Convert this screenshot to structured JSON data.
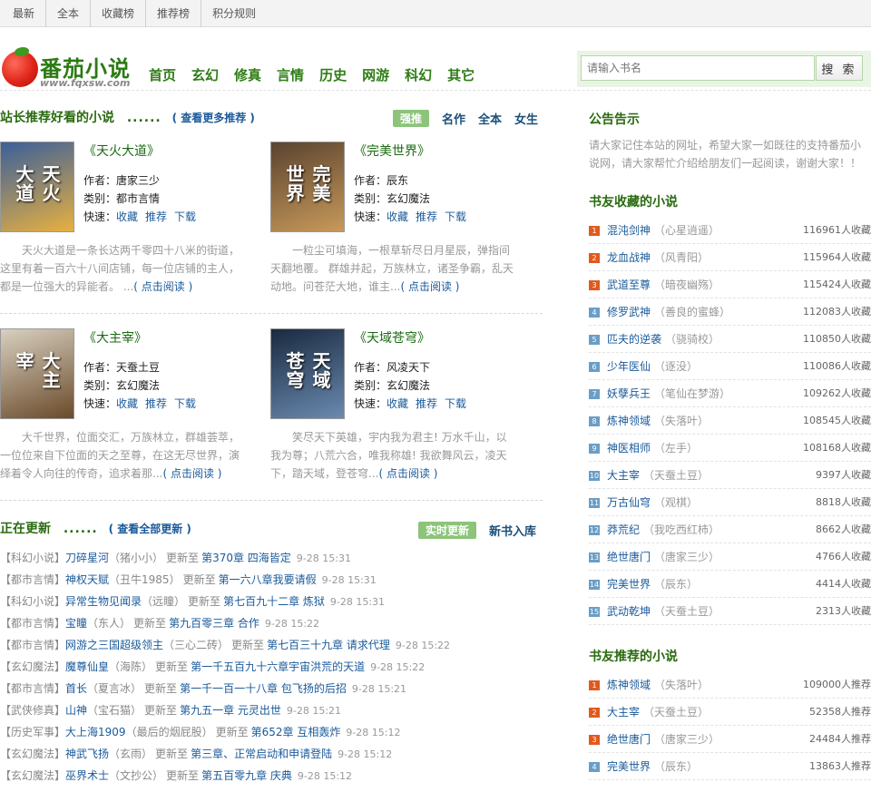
{
  "topnav": [
    "最新",
    "全本",
    "收藏榜",
    "推荐榜",
    "积分规则"
  ],
  "logo": {
    "text": "番茄小说",
    "url_text": "www.fqxsw.com",
    "icon": "tomato-icon"
  },
  "nav": [
    "首页",
    "玄幻",
    "修真",
    "言情",
    "历史",
    "网游",
    "科幻",
    "其它"
  ],
  "search": {
    "placeholder": "请输入书名",
    "button": "搜 索"
  },
  "recommend": {
    "title": "站长推荐好看的小说",
    "dots": "......",
    "more": "( 查看更多推荐 )",
    "tabs": [
      "强推",
      "名作",
      "全本",
      "女生"
    ],
    "labels": {
      "author": "作者：",
      "category": "类别：",
      "quick": "快速："
    },
    "quick_links": [
      "收藏",
      "推荐",
      "下载"
    ],
    "read_more": "( 点击阅读 )",
    "books": [
      {
        "title": "《天火大道》",
        "author": "唐家三少",
        "category": "都市言情",
        "cover_text": "天火大道",
        "cover_colors": [
          "#3a5f9a",
          "#e8b040"
        ],
        "desc": "天火大道是一条长达两千零四十八米的街道，这里有着一百六十八间店铺，每一位店铺的主人，都是一位强大的异能者。 ..."
      },
      {
        "title": "《完美世界》",
        "author": "辰东",
        "category": "玄幻魔法",
        "cover_text": "完美世界",
        "cover_colors": [
          "#5a4330",
          "#c89a5a"
        ],
        "desc": "一粒尘可填海，一根草斩尽日月星辰，弹指间天翻地覆。 群雄并起，万族林立，诸圣争霸，乱天动地。问苍茫大地，谁主..."
      },
      {
        "title": "《大主宰》",
        "author": "天蚕土豆",
        "category": "玄幻魔法",
        "cover_text": "大主宰",
        "cover_colors": [
          "#d8d0c0",
          "#6a4a2a"
        ],
        "desc": "大千世界，位面交汇，万族林立，群雄荟萃，一位位来自下位面的天之至尊，在这无尽世界，演绎着令人向往的传奇，追求着那..."
      },
      {
        "title": "《天域苍穹》",
        "author": "风凌天下",
        "category": "玄幻魔法",
        "cover_text": "天域苍穹",
        "cover_colors": [
          "#1a2a40",
          "#6a8ab0"
        ],
        "desc": "笑尽天下英雄，宇内我为君主! 万水千山，以我为尊；八荒六合，唯我称雄! 我欲舞风云，凌天下，踏天域，登苍穹..."
      }
    ]
  },
  "updates": {
    "title": "正在更新",
    "dots": "......",
    "more": "( 查看全部更新 )",
    "tabs": [
      "实时更新",
      "新书入库"
    ],
    "word_update": "更新至",
    "items": [
      {
        "cat": "【科幻小说】",
        "name": "刀碎星河",
        "author": "（猪小小）",
        "chapter": "第370章  四海皆定",
        "time": "9-28 15:31"
      },
      {
        "cat": "【都市言情】",
        "name": "神权天赋",
        "author": "（丑牛1985）",
        "chapter": "第一六八章我要请假",
        "time": "9-28 15:31"
      },
      {
        "cat": "【科幻小说】",
        "name": "异常生物见闻录",
        "author": "（远瞳）",
        "chapter": "第七百九十二章  炼狱",
        "time": "9-28 15:31"
      },
      {
        "cat": "【都市言情】",
        "name": "宝瞳",
        "author": "（东人）",
        "chapter": "第九百零三章  合作",
        "time": "9-28 15:22"
      },
      {
        "cat": "【都市言情】",
        "name": "网游之三国超级领主",
        "author": "（三心二砖）",
        "chapter": "第七百三十九章  请求代理",
        "time": "9-28 15:22"
      },
      {
        "cat": "【玄幻魔法】",
        "name": "魔尊仙皇",
        "author": "（海陈）",
        "chapter": "第一千五百九十六章宇宙洪荒的天道",
        "time": "9-28 15:22"
      },
      {
        "cat": "【都市言情】",
        "name": "首长",
        "author": "（夏言冰）",
        "chapter": "第一千一百一十八章  包飞扬的后招",
        "time": "9-28 15:21"
      },
      {
        "cat": "【武侠修真】",
        "name": "山神",
        "author": "（宝石猫）",
        "chapter": "第九五一章  元灵出世",
        "time": "9-28 15:21"
      },
      {
        "cat": "【历史军事】",
        "name": "大上海1909",
        "author": "（最后的烟屁股）",
        "chapter": "第652章  互相轰炸",
        "time": "9-28 15:12"
      },
      {
        "cat": "【玄幻魔法】",
        "name": "神武飞扬",
        "author": "（玄雨）",
        "chapter": "第三章、正常启动和申请登陆",
        "time": "9-28 15:12"
      },
      {
        "cat": "【玄幻魔法】",
        "name": "巫界术士",
        "author": "（文抄公）",
        "chapter": "第五百零九章  庆典",
        "time": "9-28 15:12"
      }
    ]
  },
  "notice": {
    "title": "公告告示",
    "text": "请大家记住本站的网址，希望大家一如既往的支持番茄小说网，请大家帮忙介绍给朋友们一起阅读，谢谢大家！！"
  },
  "fav": {
    "title": "书友收藏的小说",
    "suffix": "人收藏",
    "items": [
      {
        "num": "1",
        "name": "混沌剑神",
        "author": "（心星逍遥）",
        "count": "116961"
      },
      {
        "num": "2",
        "name": "龙血战神",
        "author": "（风青阳）",
        "count": "115964"
      },
      {
        "num": "3",
        "name": "武道至尊",
        "author": "（暗夜幽殇）",
        "count": "115424"
      },
      {
        "num": "4",
        "name": "修罗武神",
        "author": "（善良的蜜蜂）",
        "count": "112083"
      },
      {
        "num": "5",
        "name": "匹夫的逆袭",
        "author": "（骁骑校）",
        "count": "110850"
      },
      {
        "num": "6",
        "name": "少年医仙",
        "author": "（逐没）",
        "count": "110086"
      },
      {
        "num": "7",
        "name": "妖孽兵王",
        "author": "（笔仙在梦游）",
        "count": "109262"
      },
      {
        "num": "8",
        "name": "炼神领域",
        "author": "（失落叶）",
        "count": "108545"
      },
      {
        "num": "9",
        "name": "神医相师",
        "author": "（左手）",
        "count": "108168"
      },
      {
        "num": "10",
        "name": "大主宰",
        "author": "（天蚕土豆）",
        "count": "9397"
      },
      {
        "num": "11",
        "name": "万古仙穹",
        "author": "（观棋）",
        "count": "8818"
      },
      {
        "num": "12",
        "name": "莽荒纪",
        "author": "（我吃西红柿）",
        "count": "8662"
      },
      {
        "num": "13",
        "name": "绝世唐门",
        "author": "（唐家三少）",
        "count": "4766"
      },
      {
        "num": "14",
        "name": "完美世界",
        "author": "（辰东）",
        "count": "4414"
      },
      {
        "num": "15",
        "name": "武动乾坤",
        "author": "（天蚕土豆）",
        "count": "2313"
      }
    ]
  },
  "rec": {
    "title": "书友推荐的小说",
    "suffix": "人推荐",
    "items": [
      {
        "num": "1",
        "name": "炼神领域",
        "author": "（失落叶）",
        "count": "109000"
      },
      {
        "num": "2",
        "name": "大主宰",
        "author": "（天蚕土豆）",
        "count": "52358"
      },
      {
        "num": "3",
        "name": "绝世唐门",
        "author": "（唐家三少）",
        "count": "24484"
      },
      {
        "num": "4",
        "name": "完美世界",
        "author": "（辰东）",
        "count": "13863"
      }
    ]
  }
}
